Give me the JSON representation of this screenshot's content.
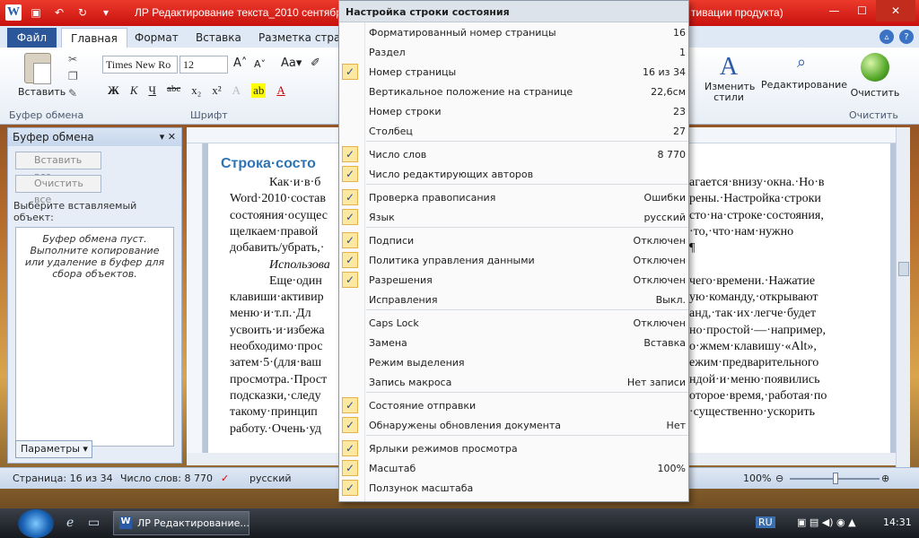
{
  "titlebar": {
    "title": "ЛР Редактирование текста_2010 сентябрь",
    "title_tail": "тивации продукта)",
    "min": "—",
    "max": "☐",
    "close": "✕"
  },
  "ribbon": {
    "tab_file": "Файл",
    "tabs": [
      "Главная",
      "Формат",
      "Вставка",
      "Разметка страни"
    ],
    "font_name": "Times New Ro",
    "font_size": "12",
    "paste_label": "Вставить",
    "group_clipboard": "Буфер обмена",
    "group_font": "Шрифт",
    "group_clear": "Очистить",
    "styles_label": "Изменить стили",
    "editing_label": "Редактирование",
    "clear_label": "Очистить",
    "format_buttons": [
      "Ж",
      "К",
      "Ч",
      "abc",
      "x₂",
      "x²"
    ]
  },
  "clipboard_pane": {
    "title": "Буфер обмена",
    "paste_all": "Вставить все",
    "clear_all": "Очистить все",
    "hint": "Выберите вставляемый объект:",
    "empty_text": "Буфер обмена пуст. Выполните копирование или удаление в буфер для сбора объектов.",
    "params": "Параметры"
  },
  "document": {
    "heading": "Строка·состо",
    "lines": [
      "Как·и·в·б",
      "Word·2010·состав",
      "состояния·осущес",
      "щелкаем·правой",
      "добавить/убрать,·",
      "Использова",
      "Еще·один",
      "клавиши·активир",
      "меню·и·т.п.·Дл",
      "усвоить·и·избежа",
      "необходимо·прос",
      "затем·5·(для·ваш",
      "просмотра.·Прост",
      "подсказки,·следу",
      "такому·принцип",
      "работу.·Очень·уд"
    ],
    "right_lines": [
      "агается·внизу·окна.·Но·в",
      "рены.·Настройка·строки",
      "сто·на·строке·состояния,",
      "·то,·что·нам·нужно",
      "¶",
      "чего·времени.·Нажатие",
      "ую·команду,·открывают",
      "анд,·так·их·легче·будет",
      "но·простой·—·например,",
      "о·жмем·клавишу·«Alt»,",
      "ежим·предварительного",
      "ндой·и·меню·появились",
      "оторое·время,·работая·по",
      "·существенно·ускорить"
    ]
  },
  "statusbar": {
    "page": "Страница: 16 из 34",
    "words": "Число слов: 8 770",
    "language": "русский",
    "zoom": "100%"
  },
  "context_menu": {
    "title": "Настройка строки состояния",
    "items": [
      {
        "label": "Форматированный номер страницы",
        "value": "16",
        "checked": false
      },
      {
        "label": "Раздел",
        "value": "1",
        "checked": false
      },
      {
        "label": "Номер страницы",
        "value": "16 из 34",
        "checked": true
      },
      {
        "label": "Вертикальное положение на странице",
        "value": "22,6см",
        "checked": false
      },
      {
        "label": "Номер строки",
        "value": "23",
        "checked": false
      },
      {
        "label": "Столбец",
        "value": "27",
        "checked": false
      },
      {
        "label": "Число слов",
        "value": "8 770",
        "checked": true
      },
      {
        "label": "Число редактирующих авторов",
        "value": "",
        "checked": true
      },
      {
        "label": "Проверка правописания",
        "value": "Ошибки",
        "checked": true
      },
      {
        "label": "Язык",
        "value": "русский",
        "checked": true
      },
      {
        "label": "Подписи",
        "value": "Отключен",
        "checked": true
      },
      {
        "label": "Политика управления данными",
        "value": "Отключен",
        "checked": true
      },
      {
        "label": "Разрешения",
        "value": "Отключен",
        "checked": true
      },
      {
        "label": "Исправления",
        "value": "Выкл.",
        "checked": false
      },
      {
        "label": "Caps Lock",
        "value": "Отключен",
        "checked": false
      },
      {
        "label": "Замена",
        "value": "Вставка",
        "checked": false
      },
      {
        "label": "Режим выделения",
        "value": "",
        "checked": false
      },
      {
        "label": "Запись макроса",
        "value": "Нет записи",
        "checked": false
      },
      {
        "label": "Состояние отправки",
        "value": "",
        "checked": true
      },
      {
        "label": "Обнаружены обновления документа",
        "value": "Нет",
        "checked": true
      },
      {
        "label": "Ярлыки режимов просмотра",
        "value": "",
        "checked": true
      },
      {
        "label": "Масштаб",
        "value": "100%",
        "checked": true
      },
      {
        "label": "Ползунок масштаба",
        "value": "",
        "checked": true
      }
    ]
  },
  "taskbar": {
    "task_label": "ЛР Редактирование...",
    "lang": "RU",
    "time": "14:31"
  }
}
